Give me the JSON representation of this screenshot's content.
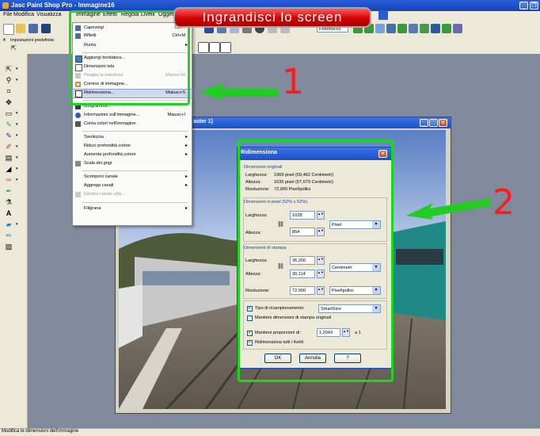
{
  "app": {
    "title": "Jasc Paint Shop Pro - Immagine16",
    "min_button": "_",
    "max_button": "❐"
  },
  "menubar": [
    "File",
    "Modifica",
    "Visualizza",
    "Immagine",
    "Effetti",
    "Regola",
    "Livelli",
    "Oggetti"
  ],
  "toolbar": {
    "zoom_select": "Fotoritocco"
  },
  "tool_options": {
    "label": "Impostazioni predefinite:"
  },
  "image_menu": {
    "items": [
      {
        "label": "Capovolgi",
        "shortcut": "Ctrl+I"
      },
      {
        "label": "Rifletti",
        "shortcut": "Ctrl+M"
      },
      {
        "label": "Ruota",
        "shortcut": ""
      },
      {
        "label": "Aggiungi bordatura...",
        "shortcut": ""
      },
      {
        "label": "Dimensioni tela",
        "shortcut": ""
      },
      {
        "label": "Ritaglia la selezione",
        "shortcut": "Maiusc+R"
      },
      {
        "label": "Cornice di immagine...",
        "shortcut": ""
      },
      {
        "label": "Ridimensiona...",
        "shortcut": "Maiusc+S"
      },
      {
        "label": "Istogramma...",
        "shortcut": ""
      },
      {
        "label": "Informazioni sull'immagine...",
        "shortcut": "Maiusc+I"
      },
      {
        "label": "Conta colori nell'immagine",
        "shortcut": ""
      },
      {
        "label": "Tavolozza",
        "shortcut": ""
      },
      {
        "label": "Riduci profondità colore",
        "shortcut": ""
      },
      {
        "label": "Aumenta profondità colore",
        "shortcut": ""
      },
      {
        "label": "Scala dei grigi",
        "shortcut": ""
      },
      {
        "label": "Scomponi canale",
        "shortcut": ""
      },
      {
        "label": "Aggrega canali",
        "shortcut": ""
      },
      {
        "label": "Elimina canale alfa...",
        "shortcut": ""
      },
      {
        "label": "Filigrana",
        "shortcut": ""
      }
    ]
  },
  "image_window": {
    "title": "Immagine16* @ 100% (Raster 1)",
    "title_visible": "aster 1)"
  },
  "banner": "Ingrandisci lo screen",
  "callouts": {
    "one": "1",
    "two": "2"
  },
  "dialog": {
    "title": "Ridimensiona",
    "original": {
      "section": "Dimensioni originali",
      "width_label": "Larghezza:",
      "width_value": "1969 pixel (69,462 Centimetri)",
      "height_label": "Altezza:",
      "height_value": "1635 pixel (57,679 Centimetri)",
      "res_label": "Risoluzione:",
      "res_value": "72,000 Pixel\\pollici"
    },
    "pixel": {
      "section": "Dimensioni in pixel (52% x 52%)",
      "width_label": "Larghezza:",
      "width_value": "1028",
      "height_label": "Altezza:",
      "height_value": "854",
      "unit": "Pixel"
    },
    "print": {
      "section": "Dimensioni di stampa",
      "width_label": "Larghezza:",
      "width_value": "36,266",
      "height_label": "Altezza:",
      "height_value": "30,114",
      "unit": "Centimetri",
      "res_label": "Risoluzione:",
      "res_value": "72,000",
      "res_unit": "Pixel\\pollici"
    },
    "options": {
      "resample_label": "Tipo di ricampionamento:",
      "resample_value": "SmartSize",
      "keep_print_label": "Mantieni dimensioni di stampa originali",
      "keep_ratio_label": "Mantieni proporzioni di:",
      "ratio_value": "1,2043",
      "ratio_suffix": "a 1",
      "all_layers_label": "Ridimensiona tutti i livelli"
    },
    "buttons": {
      "ok": "OK",
      "cancel": "Annulla",
      "help": "?"
    }
  },
  "statusbar": "Modifica le dimensioni dell'immagine",
  "colors": {
    "highlight": "#1ed61e",
    "arrow": "#22cc22",
    "callout": "#ff1a1a",
    "banner": "#d40000"
  }
}
